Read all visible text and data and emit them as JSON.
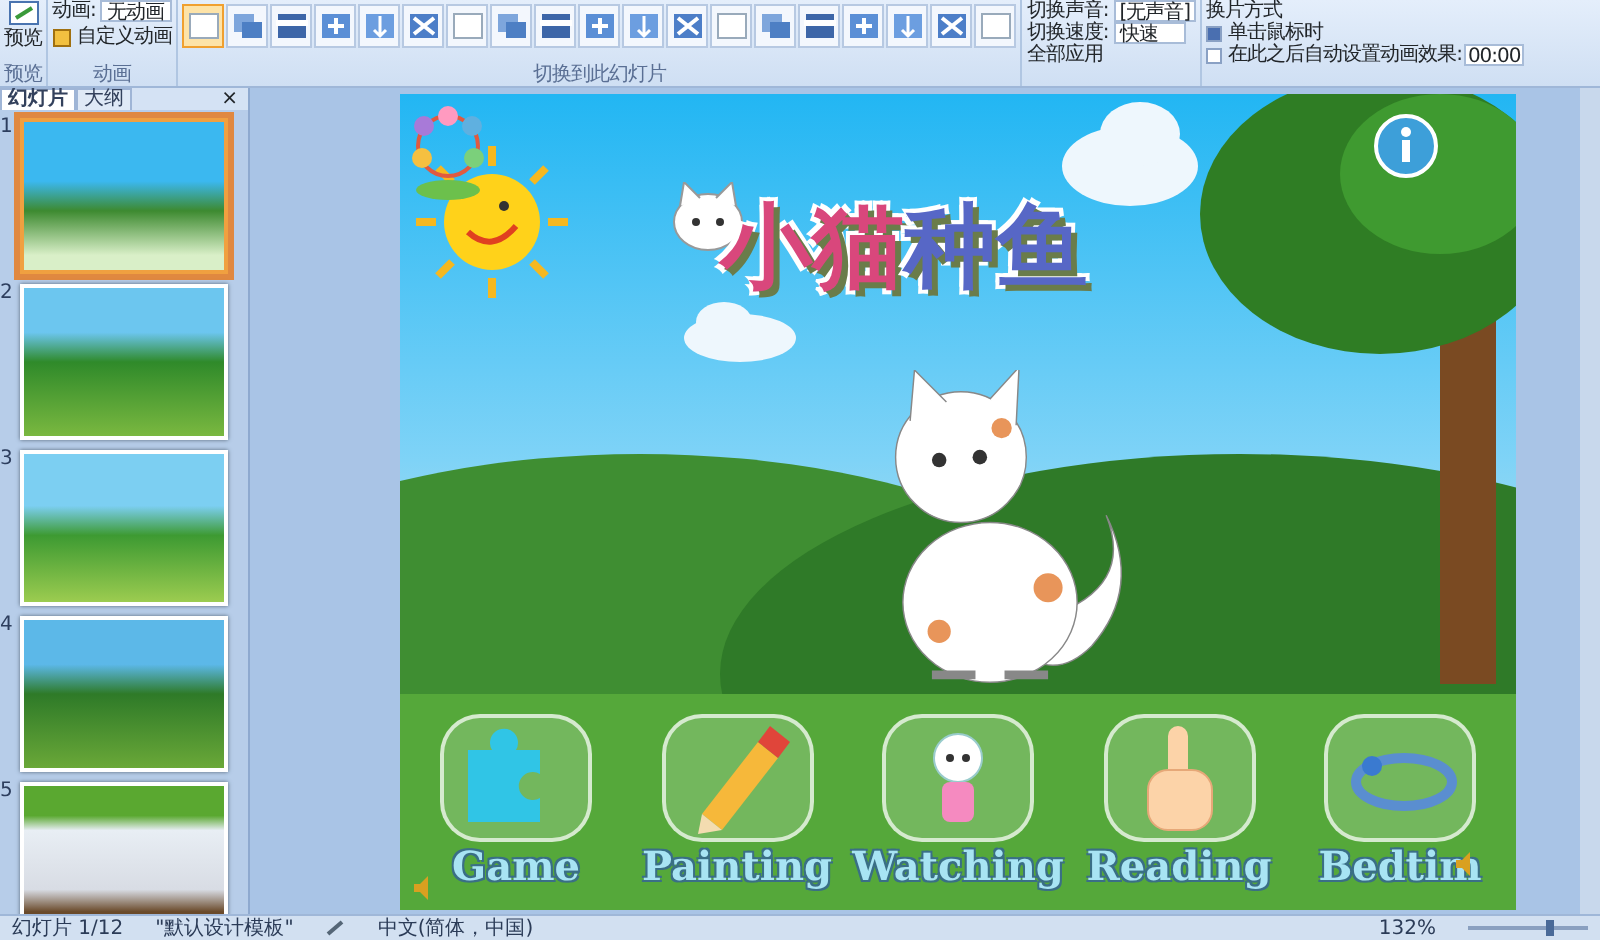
{
  "ribbon": {
    "preview_button": "预览",
    "preview_group": "预览",
    "animation_label": "动画:",
    "animation_value": "无动画",
    "custom_animation": "自定义动画",
    "animation_group": "动画",
    "transitions": [
      {
        "selected": true
      },
      {
        "selected": false
      },
      {
        "selected": false
      },
      {
        "selected": false
      },
      {
        "selected": false
      },
      {
        "selected": false
      },
      {
        "selected": false
      },
      {
        "selected": false
      },
      {
        "selected": false
      },
      {
        "selected": false
      },
      {
        "selected": false
      },
      {
        "selected": false
      },
      {
        "selected": false
      },
      {
        "selected": false
      },
      {
        "selected": false
      },
      {
        "selected": false
      },
      {
        "selected": false
      },
      {
        "selected": false
      },
      {
        "selected": false
      }
    ],
    "transition_group": "切换到此幻灯片",
    "sound_label": "切换声音:",
    "sound_value": "[无声音]",
    "speed_label": "切换速度:",
    "speed_value": "快速",
    "apply_all": "全部应用",
    "advance_heading": "换片方式",
    "advance_options": [
      {
        "label": "单击鼠标时",
        "checked": true
      },
      {
        "label": "在此之后自动设置动画效果:",
        "checked": false,
        "value": "00:00"
      }
    ]
  },
  "pane": {
    "tabs": [
      {
        "label": "幻灯片",
        "selected": true
      },
      {
        "label": "大纲",
        "selected": false
      }
    ],
    "close": "×",
    "thumbnails": [
      {
        "number": "1",
        "selected": true
      },
      {
        "number": "2",
        "selected": false
      },
      {
        "number": "3",
        "selected": false
      },
      {
        "number": "4",
        "selected": false
      },
      {
        "number": "5",
        "selected": false
      }
    ]
  },
  "slide": {
    "title_parts": [
      {
        "text": "小猫",
        "color": "#d9477c"
      },
      {
        "text": "种鱼",
        "color": "#5767c6"
      }
    ],
    "buttons": [
      {
        "label": "Game",
        "kind": "puzzle"
      },
      {
        "label": "Painting",
        "kind": "pencil"
      },
      {
        "label": "Watching",
        "kind": "doll"
      },
      {
        "label": "Reading",
        "kind": "hand"
      },
      {
        "label": "Bedtim",
        "kind": "band"
      }
    ]
  },
  "status_bar": {
    "slide": "幻灯片 1/12",
    "template": "\"默认设计模板\"",
    "language": "中文(简体，中国)",
    "zoom": "132%",
    "zoom_slider": {
      "level": 0.7
    }
  }
}
